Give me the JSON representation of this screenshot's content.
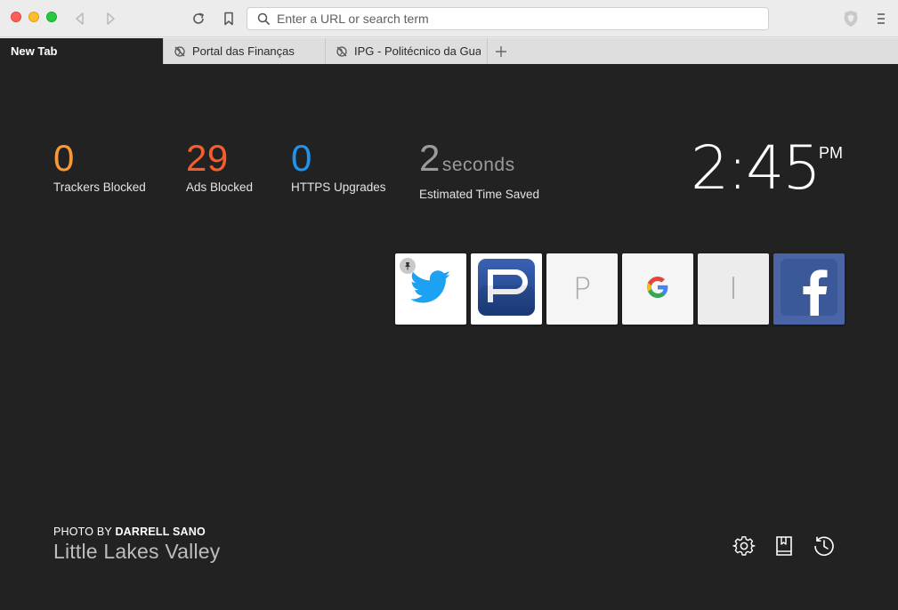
{
  "toolbar": {
    "url_placeholder": "Enter a URL or search term",
    "icons": [
      "back-arrow-icon",
      "forward-arrow-icon",
      "reload-icon",
      "bookmark-icon",
      "search-icon",
      "brave-shield-icon",
      "menu-icon"
    ]
  },
  "tabs": [
    {
      "label": "New Tab",
      "active": true
    },
    {
      "label": "Portal das Finanças",
      "active": false,
      "icon": "no-favicon-icon"
    },
    {
      "label": "IPG - Politécnico da Guarda",
      "active": false,
      "icon": "no-favicon-icon"
    }
  ],
  "stats": {
    "trackers": {
      "value": "0",
      "label": "Trackers Blocked",
      "color": "#f59a3a"
    },
    "ads": {
      "value": "29",
      "label": "Ads Blocked",
      "color": "#f55d2f"
    },
    "https": {
      "value": "0",
      "label": "HTTPS Upgrades",
      "color": "#1e94f0"
    },
    "time": {
      "value": "2",
      "unit": "seconds",
      "label": "Estimated Time Saved",
      "color": "#9b9b9b"
    }
  },
  "clock": {
    "time": "2:45",
    "ampm": "PM"
  },
  "top_sites": [
    {
      "name": "twitter",
      "icon": "twitter-bird-icon",
      "pinned": true
    },
    {
      "name": "p-logo",
      "icon": "p-logo-icon"
    },
    {
      "name": "p-letter",
      "letter": "P"
    },
    {
      "name": "google",
      "icon": "google-g-icon"
    },
    {
      "name": "i-letter",
      "letter": "I"
    },
    {
      "name": "facebook",
      "icon": "facebook-f-icon"
    }
  ],
  "photo_credit": {
    "prefix": "PHOTO BY",
    "author": "DARRELL SANO",
    "location": "Little Lakes Valley"
  },
  "bottom_actions": [
    "settings-gear-icon",
    "bookmarks-book-icon",
    "history-clock-icon"
  ],
  "colors": {
    "background": "#222222",
    "accent_orange": "#f59a3a",
    "accent_red": "#f55d2f",
    "accent_blue": "#1e94f0"
  }
}
